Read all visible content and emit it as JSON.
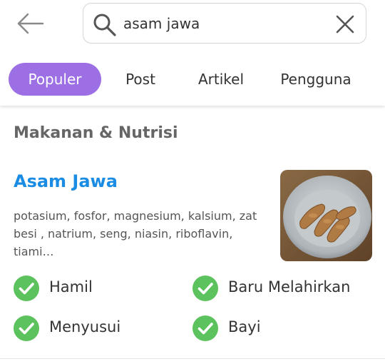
{
  "search": {
    "value": "asam jawa"
  },
  "tabs": [
    {
      "label": "Populer",
      "active": true
    },
    {
      "label": "Post",
      "active": false
    },
    {
      "label": "Artikel",
      "active": false
    },
    {
      "label": "Pengguna",
      "active": false
    }
  ],
  "section": {
    "title": "Makanan & Nutrisi"
  },
  "result": {
    "title": "Asam Jawa",
    "description": "potasium, fosfor, magnesium, kalsium, zat besi , natrium, seng, niasin, riboflavin, tiami…",
    "image_icon": "tamarind-photo",
    "statuses": [
      {
        "label": "Hamil",
        "icon": "check-circle-icon"
      },
      {
        "label": "Baru Melahirkan",
        "icon": "check-circle-icon"
      },
      {
        "label": "Menyusui",
        "icon": "check-circle-icon"
      },
      {
        "label": "Bayi",
        "icon": "check-circle-icon"
      }
    ]
  },
  "colors": {
    "accent_purple": "#9c6fe4",
    "link_blue": "#1a8ce3",
    "check_green": "#5cc25e"
  }
}
